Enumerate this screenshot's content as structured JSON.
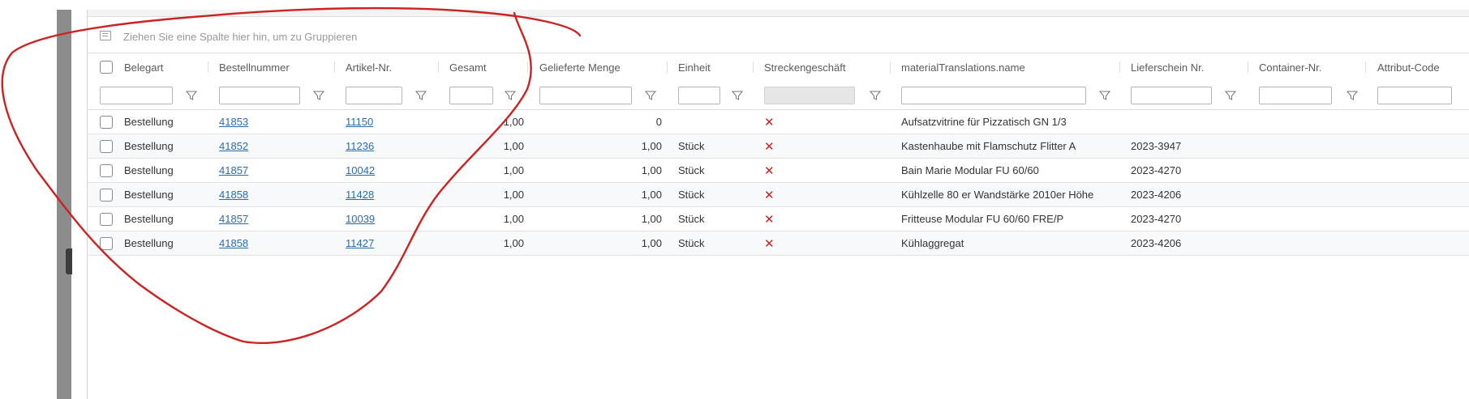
{
  "group_panel": {
    "hint": "Ziehen Sie eine Spalte hier hin, um zu Gruppieren",
    "icon": "group-panel-icon"
  },
  "columns": [
    {
      "key": "belegart",
      "label": "Belegart"
    },
    {
      "key": "bestellnummer",
      "label": "Bestellnummer"
    },
    {
      "key": "artikel_nr",
      "label": "Artikel-Nr."
    },
    {
      "key": "gesamt",
      "label": "Gesamt"
    },
    {
      "key": "gelieferte_menge",
      "label": "Gelieferte Menge"
    },
    {
      "key": "einheit",
      "label": "Einheit"
    },
    {
      "key": "streckengeschaeft",
      "label": "Streckengeschäft"
    },
    {
      "key": "material_name",
      "label": "materialTranslations.name"
    },
    {
      "key": "lieferschein_nr",
      "label": "Lieferschein Nr."
    },
    {
      "key": "container_nr",
      "label": "Container-Nr."
    },
    {
      "key": "attribut_code",
      "label": "Attribut-Code"
    }
  ],
  "rows": [
    {
      "belegart": "Bestellung",
      "bestellnummer": "41853",
      "artikel_nr": "11150",
      "gesamt": "1,00",
      "gelieferte_menge": "0",
      "einheit": "",
      "streckengeschaeft": "✕",
      "material_name": "Aufsatzvitrine für Pizzatisch GN 1/3",
      "lieferschein_nr": ""
    },
    {
      "belegart": "Bestellung",
      "bestellnummer": "41852",
      "artikel_nr": "11236",
      "gesamt": "1,00",
      "gelieferte_menge": "1,00",
      "einheit": "Stück",
      "streckengeschaeft": "✕",
      "material_name": "Kastenhaube mit Flamschutz Flitter A",
      "lieferschein_nr": "2023-3947"
    },
    {
      "belegart": "Bestellung",
      "bestellnummer": "41857",
      "artikel_nr": "10042",
      "gesamt": "1,00",
      "gelieferte_menge": "1,00",
      "einheit": "Stück",
      "streckengeschaeft": "✕",
      "material_name": "Bain Marie Modular FU 60/60",
      "lieferschein_nr": "2023-4270"
    },
    {
      "belegart": "Bestellung",
      "bestellnummer": "41858",
      "artikel_nr": "11428",
      "gesamt": "1,00",
      "gelieferte_menge": "1,00",
      "einheit": "Stück",
      "streckengeschaeft": "✕",
      "material_name": "Kühlzelle 80 er Wandstärke 2010er Höhe",
      "lieferschein_nr": "2023-4206"
    },
    {
      "belegart": "Bestellung",
      "bestellnummer": "41857",
      "artikel_nr": "10039",
      "gesamt": "1,00",
      "gelieferte_menge": "1,00",
      "einheit": "Stück",
      "streckengeschaeft": "✕",
      "material_name": "Fritteuse Modular FU 60/60 FRE/P",
      "lieferschein_nr": "2023-4270"
    },
    {
      "belegart": "Bestellung",
      "bestellnummer": "41858",
      "artikel_nr": "11427",
      "gesamt": "1,00",
      "gelieferte_menge": "1,00",
      "einheit": "Stück",
      "streckengeschaeft": "✕",
      "material_name": "Kühlaggregat",
      "lieferschein_nr": "2023-4206"
    }
  ],
  "colors": {
    "link": "#2b6cb0",
    "cross": "#d12020",
    "annotation": "#cc2222"
  }
}
